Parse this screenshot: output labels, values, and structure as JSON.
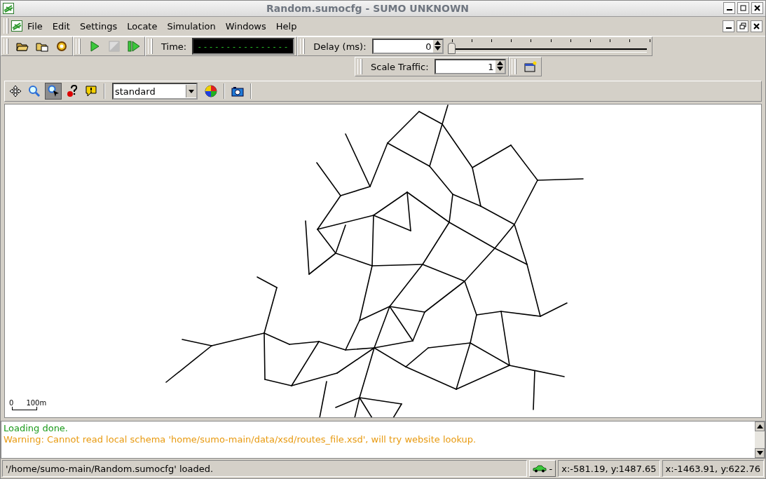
{
  "window": {
    "title": "Random.sumocfg - SUMO UNKNOWN"
  },
  "menu": [
    {
      "label": "File"
    },
    {
      "label": "Edit"
    },
    {
      "label": "Settings"
    },
    {
      "label": "Locate"
    },
    {
      "label": "Simulation"
    },
    {
      "label": "Windows"
    },
    {
      "label": "Help"
    }
  ],
  "toolbar": {
    "time_label": "Time:",
    "time_value": "----------------",
    "delay": {
      "label": "Delay (ms):",
      "value": "0",
      "level": 0
    },
    "scale_traffic": {
      "label": "Scale Traffic:",
      "value": "1"
    }
  },
  "view_tools": [
    {
      "kind": "recenter",
      "selected": false
    },
    {
      "kind": "zoom",
      "selected": false
    },
    {
      "kind": "zoom-cursor",
      "selected": true
    },
    {
      "kind": "query",
      "selected": false
    },
    {
      "kind": "warning",
      "selected": false
    }
  ],
  "view": {
    "scheme": "standard",
    "scale_bar": {
      "zero": "0",
      "length": "100m"
    }
  },
  "messages": [
    {
      "kind": "info",
      "text": "Loading done."
    },
    {
      "kind": "warning",
      "text": "Warning: Cannot read local schema 'home/sumo-main/data/xsd/routes_file.xsd', will try website lookup."
    }
  ],
  "status_bar": {
    "message": "'/home/sumo-main/Random.sumocfg' loaded.",
    "vehicle_label": "-",
    "coords": [
      "x:-581.19, y:1487.65",
      "x:-1463.91, y:622.76"
    ]
  }
}
